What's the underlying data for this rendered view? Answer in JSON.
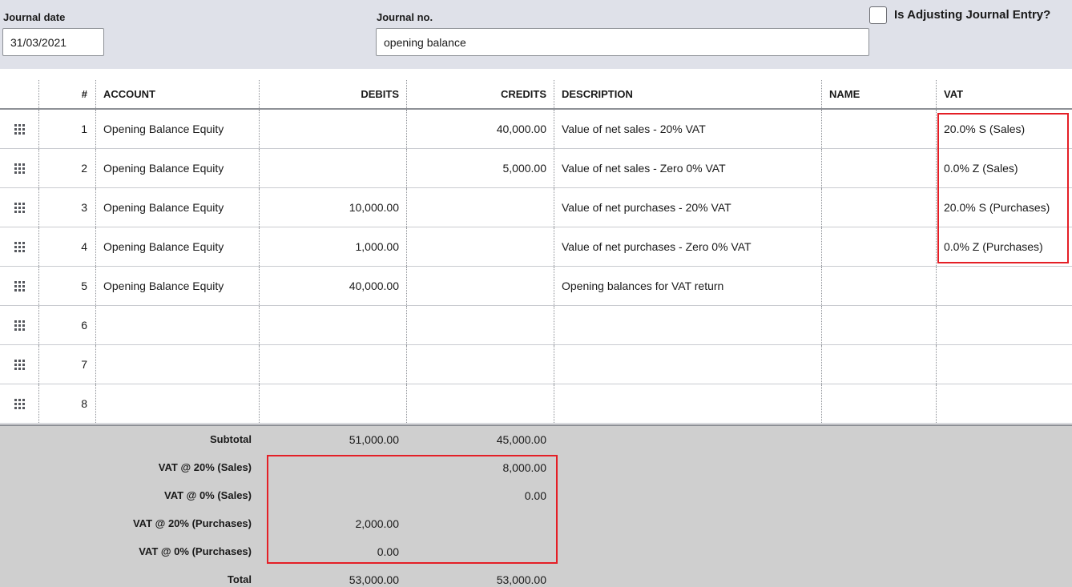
{
  "header": {
    "journal_date_label": "Journal date",
    "journal_date_value": "31/03/2021",
    "journal_no_label": "Journal no.",
    "journal_no_value": "opening balance",
    "adjusting_label": "Is Adjusting Journal Entry?"
  },
  "table": {
    "columns": {
      "num": "#",
      "account": "ACCOUNT",
      "debits": "DEBITS",
      "credits": "CREDITS",
      "description": "DESCRIPTION",
      "name": "NAME",
      "vat": "VAT"
    },
    "rows": [
      {
        "num": "1",
        "account": "Opening Balance Equity",
        "debit": "",
        "credit": "40,000.00",
        "description": "Value of net sales - 20% VAT",
        "name": "",
        "vat": "20.0% S (Sales)"
      },
      {
        "num": "2",
        "account": "Opening Balance Equity",
        "debit": "",
        "credit": "5,000.00",
        "description": "Value of net sales - Zero 0% VAT",
        "name": "",
        "vat": "0.0% Z (Sales)"
      },
      {
        "num": "3",
        "account": "Opening Balance Equity",
        "debit": "10,000.00",
        "credit": "",
        "description": "Value of net purchases - 20% VAT",
        "name": "",
        "vat": "20.0% S (Purchases)"
      },
      {
        "num": "4",
        "account": "Opening Balance Equity",
        "debit": "1,000.00",
        "credit": "",
        "description": "Value of net purchases - Zero 0% VAT",
        "name": "",
        "vat": "0.0% Z (Purchases)"
      },
      {
        "num": "5",
        "account": "Opening Balance Equity",
        "debit": "40,000.00",
        "credit": "",
        "description": "Opening balances for VAT return",
        "name": "",
        "vat": ""
      },
      {
        "num": "6",
        "account": "",
        "debit": "",
        "credit": "",
        "description": "",
        "name": "",
        "vat": ""
      },
      {
        "num": "7",
        "account": "",
        "debit": "",
        "credit": "",
        "description": "",
        "name": "",
        "vat": ""
      },
      {
        "num": "8",
        "account": "",
        "debit": "",
        "credit": "",
        "description": "",
        "name": "",
        "vat": ""
      }
    ]
  },
  "summary": [
    {
      "label": "Subtotal",
      "debit": "51,000.00",
      "credit": "45,000.00"
    },
    {
      "label": "VAT @ 20% (Sales)",
      "debit": "",
      "credit": "8,000.00"
    },
    {
      "label": "VAT @ 0% (Sales)",
      "debit": "",
      "credit": "0.00"
    },
    {
      "label": "VAT @ 20% (Purchases)",
      "debit": "2,000.00",
      "credit": ""
    },
    {
      "label": "VAT @ 0% (Purchases)",
      "debit": "0.00",
      "credit": ""
    },
    {
      "label": "Total",
      "debit": "53,000.00",
      "credit": "53,000.00"
    }
  ],
  "colors": {
    "header_bg": "#dfe1e9",
    "footer_bg": "#cfcfcf",
    "highlight": "#e41f26"
  }
}
